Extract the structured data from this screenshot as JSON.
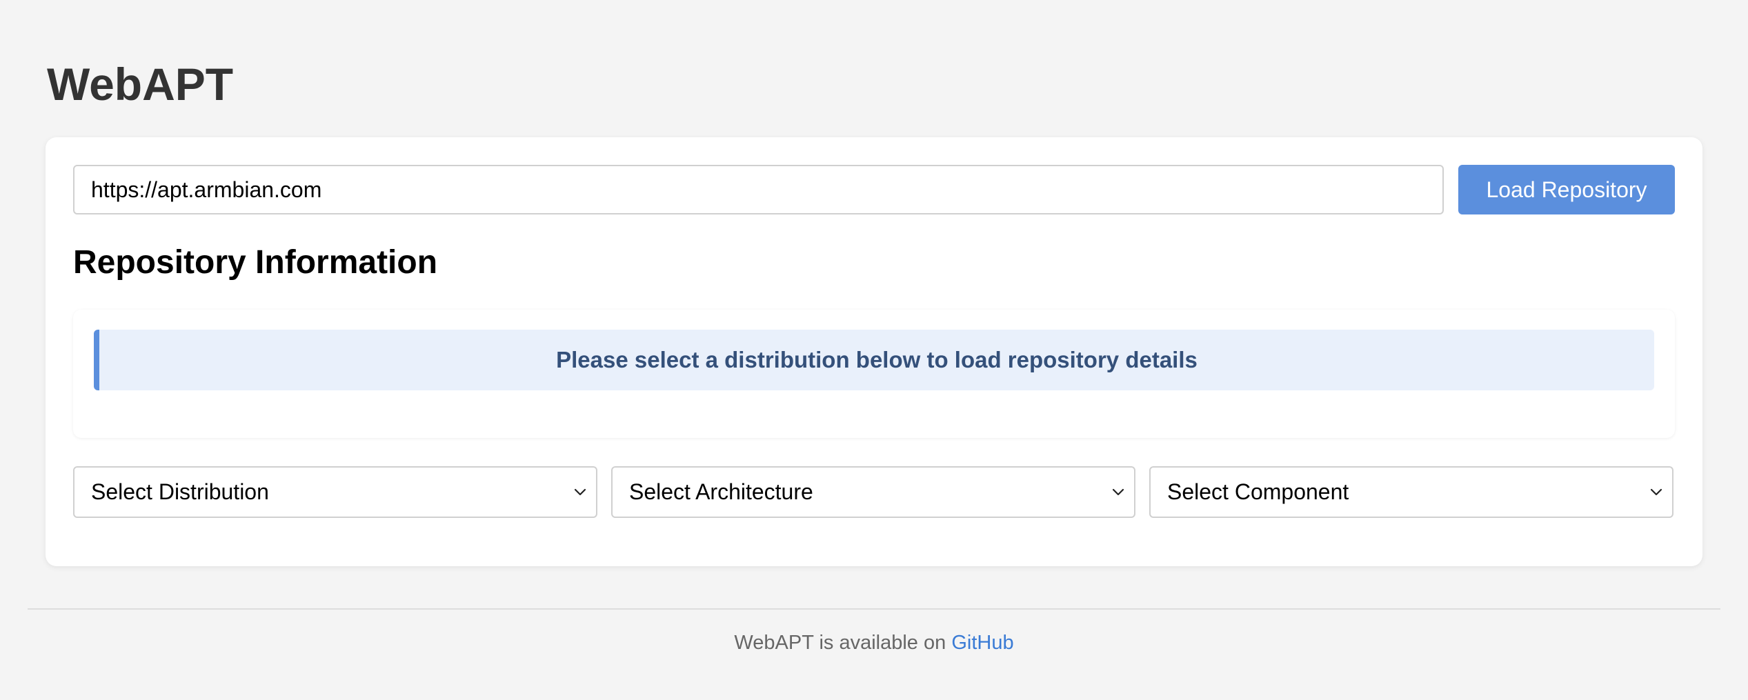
{
  "app": {
    "title": "WebAPT"
  },
  "repo_form": {
    "url_value": "https://apt.armbian.com",
    "load_button_label": "Load Repository"
  },
  "repository_info": {
    "heading": "Repository Information",
    "message": "Please select a distribution below to load repository details"
  },
  "selectors": {
    "distribution": "Select Distribution",
    "architecture": "Select Architecture",
    "component": "Select Component"
  },
  "footer": {
    "text": "WebAPT is available on",
    "link_label": "GitHub"
  },
  "colors": {
    "accent": "#5b8fdd",
    "banner_background": "#e9f0fb",
    "banner_text": "#34507a",
    "link": "#3a7bd5",
    "page_background": "#f4f4f4"
  },
  "icons": {
    "select_chevron": "chevron-down-icon"
  }
}
